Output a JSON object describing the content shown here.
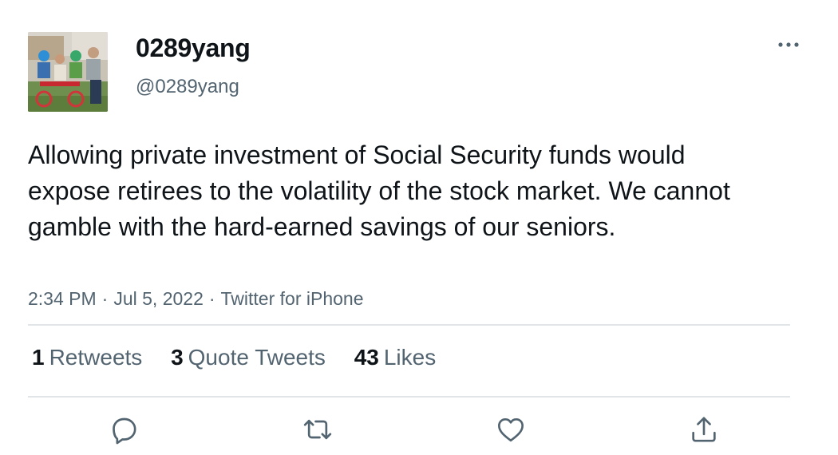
{
  "user": {
    "display_name": "0289yang",
    "handle": "@0289yang"
  },
  "tweet": {
    "text": "Allowing private investment of Social Security funds would expose retirees to the volatility of the stock market. We cannot gamble with the hard-earned savings of our seniors.",
    "time": "2:34 PM",
    "date": "Jul 5, 2022",
    "source": "Twitter for iPhone",
    "separator": "·"
  },
  "stats": {
    "retweets_count": "1",
    "retweets_label": "Retweets",
    "quotes_count": "3",
    "quotes_label": "Quote Tweets",
    "likes_count": "43",
    "likes_label": "Likes"
  },
  "actions": {
    "reply_icon": "reply-icon",
    "retweet_icon": "retweet-icon",
    "like_icon": "heart-icon",
    "share_icon": "share-icon",
    "more_icon": "more-dots-icon"
  },
  "colors": {
    "text_primary": "#0f1419",
    "text_secondary": "#536471",
    "icon": "#536471",
    "divider": "#e1e5e8"
  }
}
